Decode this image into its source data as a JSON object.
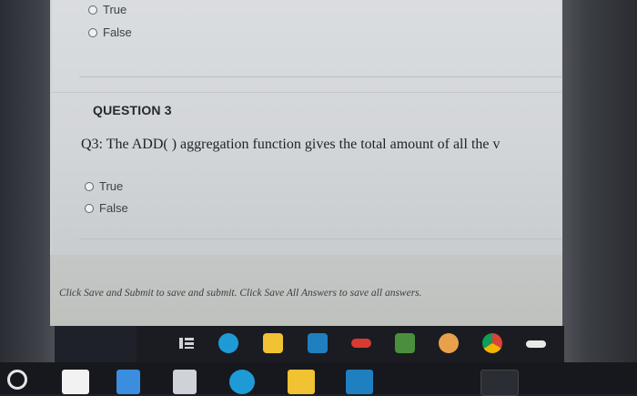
{
  "previous_question": {
    "options": [
      "True",
      "False"
    ]
  },
  "question": {
    "title": "QUESTION 3",
    "text": "Q3: The ADD( ) aggregation function gives the total  amount of all the v",
    "options": [
      "True",
      "False"
    ]
  },
  "footer": {
    "instructions": "Click Save and Submit to save and submit. Click Save All Answers to save all answers."
  },
  "taskbar": {
    "icons": [
      "task-view-icon",
      "edge-icon",
      "file-explorer-icon",
      "mail-icon",
      "app-icon",
      "store-icon",
      "photos-icon",
      "chrome-icon",
      "app-icon"
    ],
    "colors": {
      "edge": "#1e9bd7",
      "explorer": "#f1c232",
      "mail": "#1f7fbf",
      "red": "#d93a2f",
      "chrome": "#db4437"
    }
  }
}
